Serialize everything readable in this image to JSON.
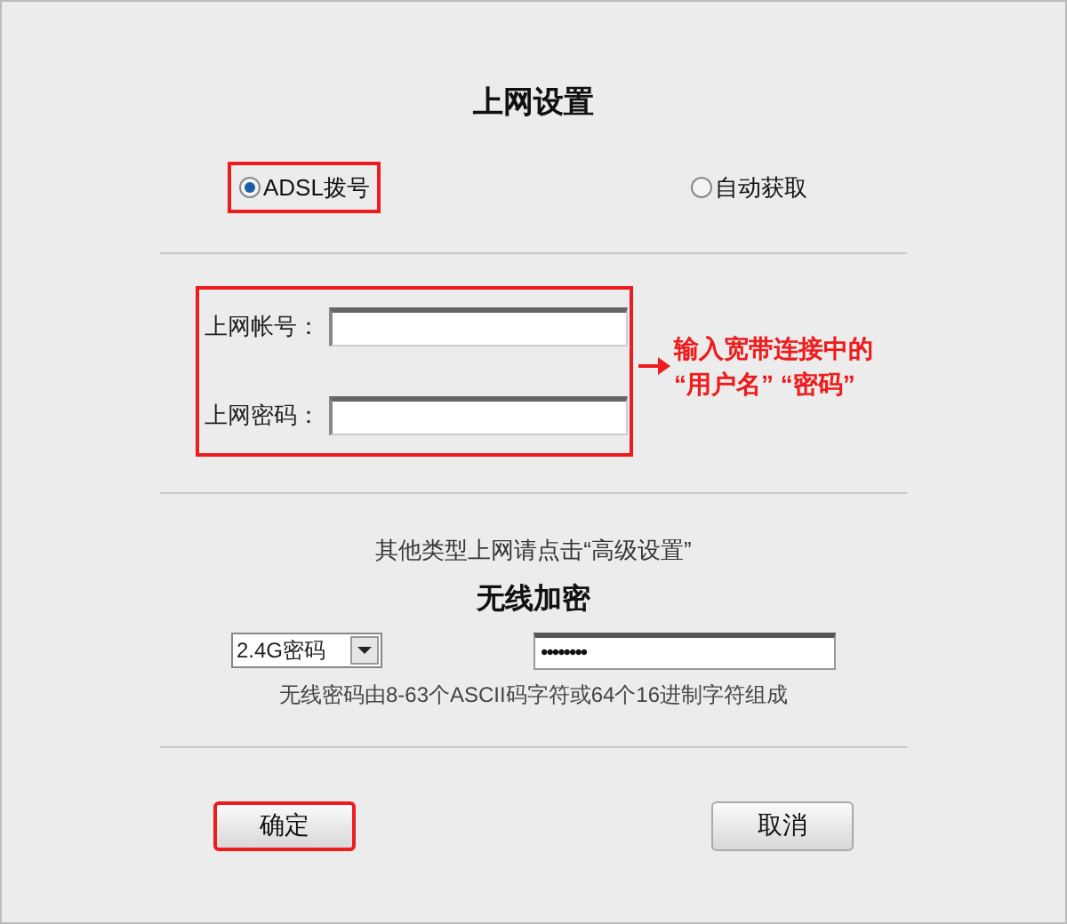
{
  "title": "上网设置",
  "connection_types": [
    {
      "label": "ADSL拨号",
      "selected": true,
      "highlighted": true
    },
    {
      "label": "自动获取",
      "selected": false,
      "highlighted": false
    }
  ],
  "account_fields": {
    "highlighted": true,
    "fields": [
      {
        "label": "上网帐号："
      },
      {
        "label": "上网密码："
      }
    ]
  },
  "annotation": {
    "lines": [
      "输入宽带连接中的",
      "“用户名” “密码”"
    ]
  },
  "advanced_hint": "其他类型上网请点击“高级设置”",
  "wireless": {
    "heading": "无线加密",
    "band_select": "2.4G密码",
    "password": "••••••••",
    "note": "无线密码由8-63个ASCII码字符或64个16进制字符组成"
  },
  "buttons": [
    {
      "label": "确定",
      "highlighted": true
    },
    {
      "label": "取消",
      "highlighted": false
    }
  ]
}
